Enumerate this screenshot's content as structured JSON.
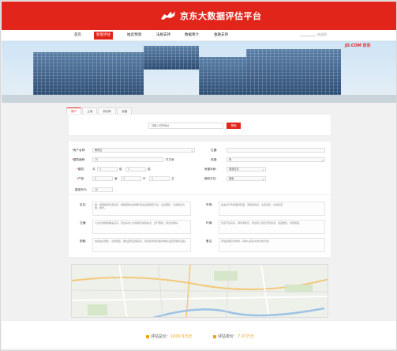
{
  "header": {
    "title": "京东大数据评估平台"
  },
  "nav": {
    "items": [
      {
        "label": "首页"
      },
      {
        "label": "智能评估"
      },
      {
        "label": "拍卖预测"
      },
      {
        "label": "法规支持"
      },
      {
        "label": "数据简介"
      },
      {
        "label": "金融支持"
      }
    ],
    "active_index": 1,
    "login_text": "欢迎您"
  },
  "banner": {
    "brand": "JD.COM 京东"
  },
  "tabs": [
    {
      "label": "房产"
    },
    {
      "label": "土地"
    },
    {
      "label": "机动车"
    },
    {
      "label": "设备"
    }
  ],
  "search": {
    "placeholder": "请输入您的地址",
    "button_label": "搜索"
  },
  "form": {
    "property_name_label": "房产名称:",
    "property_name_value": "朝阳区",
    "location_label": "位置:",
    "building_area_label": "建筑面积:",
    "building_area_value": "75",
    "building_area_unit": "平方米",
    "elevator_label": "电梯:",
    "elevator_value": "有",
    "floor_label": "楼层:",
    "floor_value_1": "1",
    "floor_value_2": "1",
    "floor_sep": "层",
    "floor_sep2": "共",
    "floor_sep3": "层",
    "decoration_label": "房屋年龄:",
    "decoration_value": "普通住宅",
    "layout_label": "户型:",
    "layout_value_1": "2",
    "layout_value_2": "1",
    "layout_value_3": "1",
    "layout_u1": "室",
    "layout_u2": "厅",
    "layout_u3": "卫",
    "orientation_label": "朝向方位:",
    "orientation_value": "朝南",
    "year_label": "建成年代:",
    "year_value": "10"
  },
  "info": [
    {
      "label": "区位:",
      "text": "楼、楼层相邻位置良好、楼层结构交通便利周边设施配套齐全，生活便利，交通通达方便，繁华。"
    },
    {
      "label": "交通:",
      "text": "公共交通网络覆盖完善，周边多条公交线路及地铁站点，出行便捷，通达性较好。"
    },
    {
      "label": "配套:",
      "text": "地铁站点便利、交通便捷、居住配套设施完善，周边有商场及超市等商业配套服务设施。"
    },
    {
      "label": "环境:",
      "text": "社区环境良好，绿化率较高，周边有公园及景观资源，适宜居住，邻里和睦。"
    },
    {
      "label": "市场:",
      "text": "此类房产市场需求旺盛，流通性较好，交易活跃，价格稳定。"
    },
    {
      "label": "备注:",
      "text": "评估结果仅供参考，具体以实际交易价格为准。"
    }
  ],
  "footer": {
    "total_label": "评估总价：",
    "total_value": "1000.5万元",
    "unit_label": "评估单价：",
    "unit_value": "7.07万元"
  }
}
